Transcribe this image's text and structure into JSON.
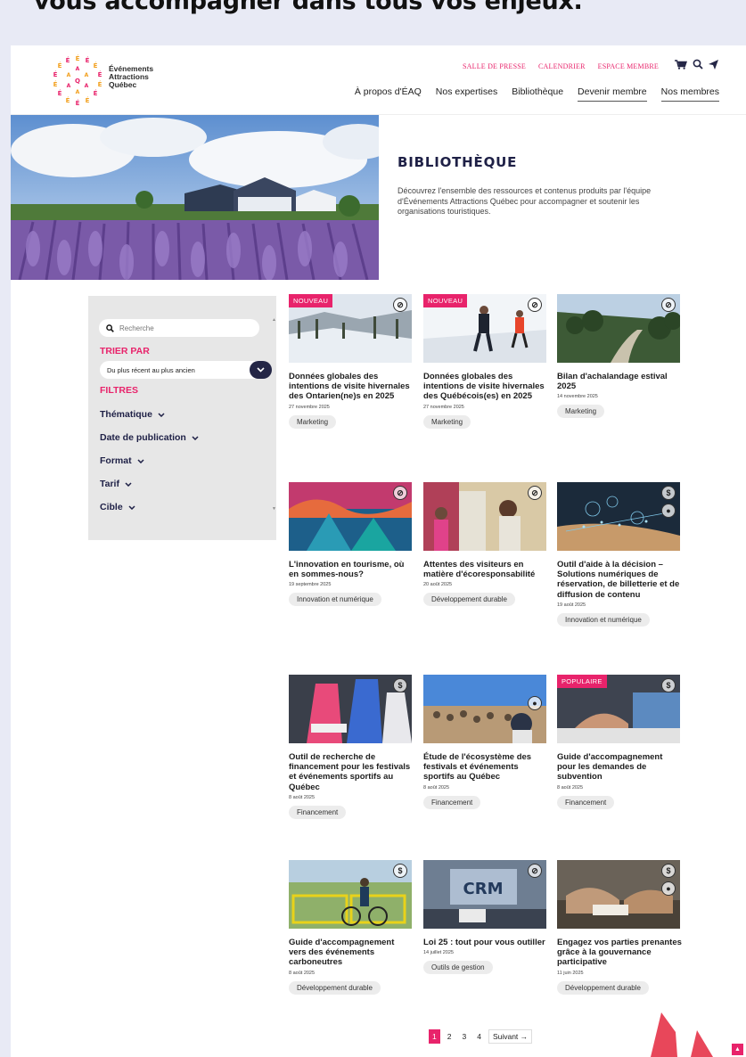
{
  "outer_title": "vous accompagner dans tous vos enjeux.",
  "logo": {
    "line1": "Événements",
    "line2": "Attractions",
    "line3": "Québec"
  },
  "util_nav": [
    "SALLE DE PRESSE",
    "CALENDRIER",
    "ESPACE MEMBRE"
  ],
  "main_nav": [
    "À propos d'ÉAQ",
    "Nos expertises",
    "Bibliothèque",
    "Devenir membre",
    "Nos membres"
  ],
  "hero": {
    "title": "BIBLIOTHÈQUE",
    "desc": "Découvrez l'ensemble des ressources et contenus produits par l'équipe d'Événements Attractions Québec pour accompagner et soutenir les organisations touristiques."
  },
  "sidebar": {
    "search_placeholder": "Recherche",
    "sort_label": "TRIER PAR",
    "sort_value": "Du plus récent au plus ancien",
    "filters_label": "FILTRES",
    "filters": [
      "Thématique",
      "Date de publication",
      "Format",
      "Tarif",
      "Cible"
    ]
  },
  "cards": [
    {
      "badge": "NOUVEAU",
      "title": "Données globales des intentions de visite hivernales des Ontarien(ne)s en 2025",
      "date": "27 novembre 2025",
      "tag": "Marketing"
    },
    {
      "badge": "NOUVEAU",
      "title": "Données globales des intentions de visite hivernales des Québécois(es) en 2025",
      "date": "27 novembre 2025",
      "tag": "Marketing"
    },
    {
      "badge": "",
      "title": "Bilan d'achalandage estival 2025",
      "date": "14 novembre 2025",
      "tag": "Marketing"
    },
    {
      "badge": "",
      "title": "L'innovation en tourisme, où en sommes-nous?",
      "date": "19 septembre 2025",
      "tag": "Innovation et numérique"
    },
    {
      "badge": "",
      "title": "Attentes des visiteurs en matière d'écoresponsabilité",
      "date": "20 août 2025",
      "tag": "Développement durable"
    },
    {
      "badge": "",
      "title": "Outil d'aide à la décision – Solutions numériques de réservation, de billetterie et de diffusion de contenu",
      "date": "19 août 2025",
      "tag": "Innovation et numérique"
    },
    {
      "badge": "",
      "title": "Outil de recherche de financement pour les festivals et événements sportifs au Québec",
      "date": "8 août 2025",
      "tag": "Financement"
    },
    {
      "badge": "",
      "title": "Étude de l'écosystème des festivals et événements sportifs au Québec",
      "date": "8 août 2025",
      "tag": "Financement"
    },
    {
      "badge": "POPULAIRE",
      "title": "Guide d'accompagnement pour les demandes de subvention",
      "date": "8 août 2025",
      "tag": "Financement"
    },
    {
      "badge": "",
      "title": "Guide d'accompagnement vers des événements carboneutres",
      "date": "8 août 2025",
      "tag": "Développement durable"
    },
    {
      "badge": "",
      "title": "Loi 25 : tout pour vous outiller",
      "date": "14 juillet 2025",
      "tag": "Outils de gestion"
    },
    {
      "badge": "",
      "title": "Engagez vos parties prenantes grâce à la gouvernance participative",
      "date": "11 juin 2025",
      "tag": "Développement durable"
    }
  ],
  "crm_text": "CRM",
  "pagination": [
    "1",
    "2",
    "3",
    "4",
    "Suivant →"
  ],
  "colors": {
    "accent": "#e8236b",
    "navy": "#1e2046",
    "bg": "#e8eaf5"
  }
}
